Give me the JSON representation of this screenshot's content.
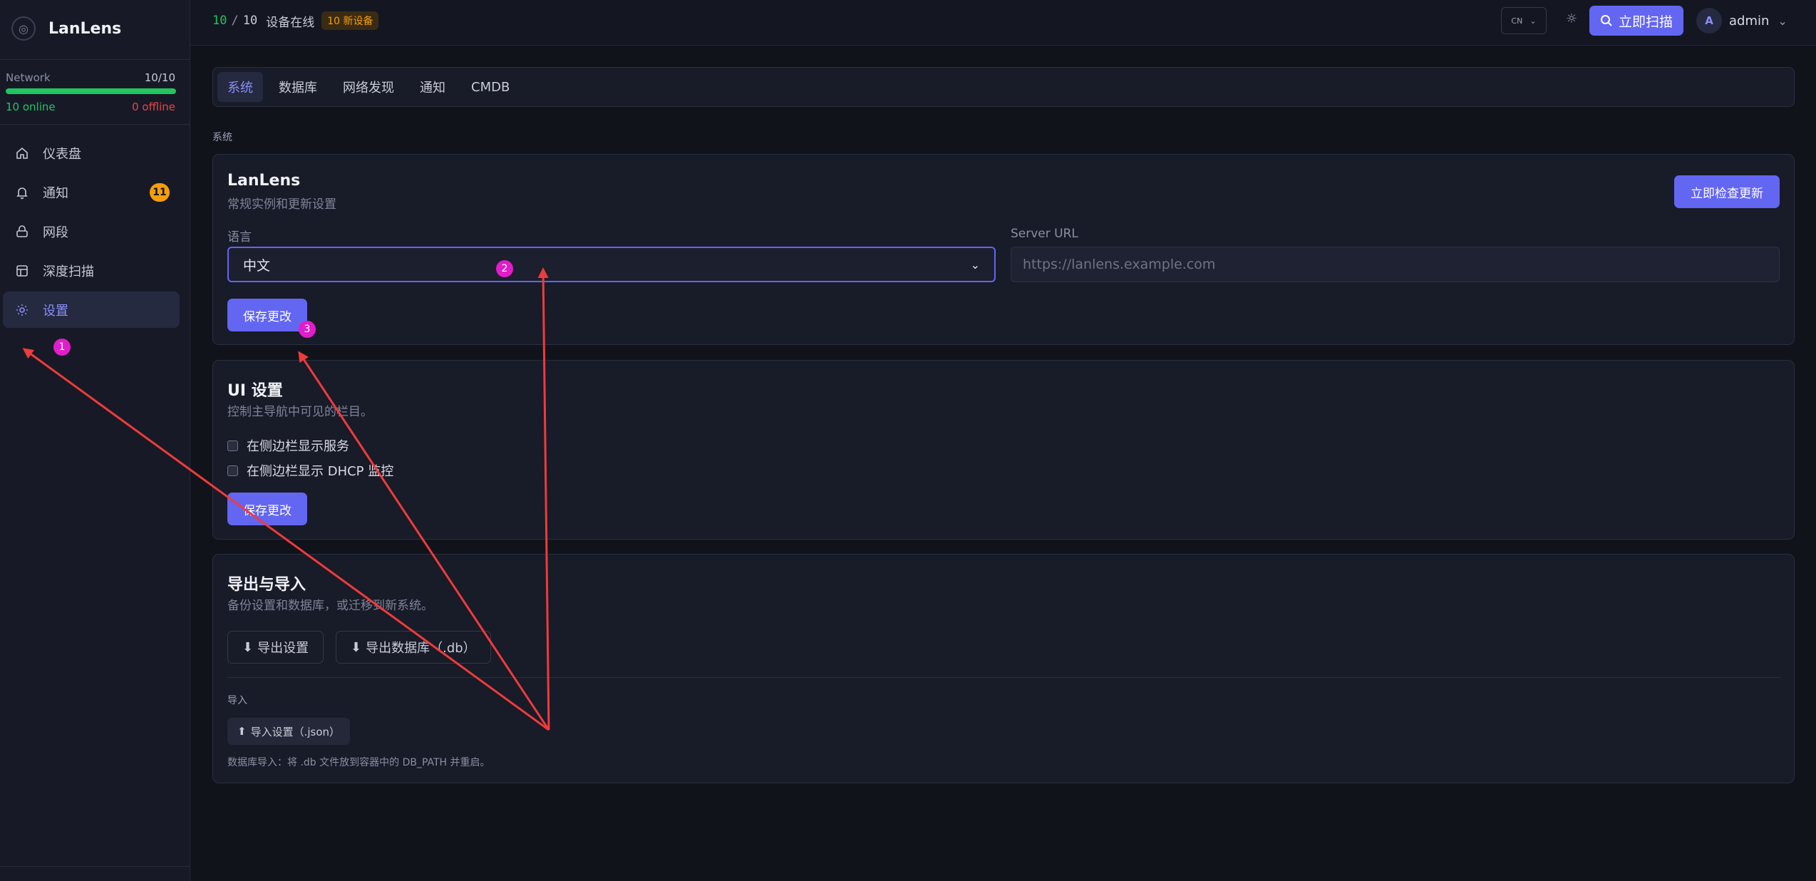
{
  "sidebar": {
    "brand": "LanLens",
    "network": {
      "label": "Network",
      "count": "10/10",
      "online_fraction": 1.0,
      "online": "10 online",
      "offline": "0 offline"
    },
    "items": [
      {
        "label": "仪表盘",
        "icon": "home-icon"
      },
      {
        "label": "通知",
        "icon": "bell-icon",
        "badge": "11"
      },
      {
        "label": "网段",
        "icon": "network-segment-icon"
      },
      {
        "label": "深度扫描",
        "icon": "table-icon"
      },
      {
        "label": "设置",
        "icon": "gear-icon",
        "active": true
      }
    ]
  },
  "header": {
    "online": "10",
    "slash": "/",
    "total": "10",
    "online_label": "设备在线",
    "new_devices": "10 新设备",
    "lang": "CN",
    "scan_label": "立即扫描",
    "avatar": "A",
    "user": "admin"
  },
  "tabs": [
    "系统",
    "数据库",
    "网络发现",
    "通知",
    "CMDB"
  ],
  "section_label": "系统",
  "system_card": {
    "title": "LanLens",
    "subtitle": "常规实例和更新设置",
    "check_update": "立即检查更新",
    "language_label": "语言",
    "language_value": "中文",
    "server_url_label": "Server URL",
    "server_url_placeholder": "https://lanlens.example.com",
    "save": "保存更改"
  },
  "ui_card": {
    "title": "UI 设置",
    "subtitle": "控制主导航中可见的栏目。",
    "options": [
      "在侧边栏显示服务",
      "在侧边栏显示 DHCP 监控"
    ],
    "save": "保存更改"
  },
  "export_card": {
    "title": "导出与导入",
    "subtitle": "备份设置和数据库，或迁移到新系统。",
    "export_settings": "导出设置",
    "export_db": "导出数据库（.db）",
    "import_label": "导入",
    "import_settings": "导入设置（.json）",
    "note": "数据库导入：将 .db 文件放到容器中的 DB_PATH 并重启。"
  },
  "annotations": {
    "markers": [
      "1",
      "2",
      "3"
    ],
    "arrow_color": "#ef3b3b",
    "marker_color": "#e11dc9"
  },
  "colors": {
    "accent": "#6366f1",
    "online": "#22c55e",
    "offline": "#ef4444",
    "badge": "#f59e0b"
  }
}
